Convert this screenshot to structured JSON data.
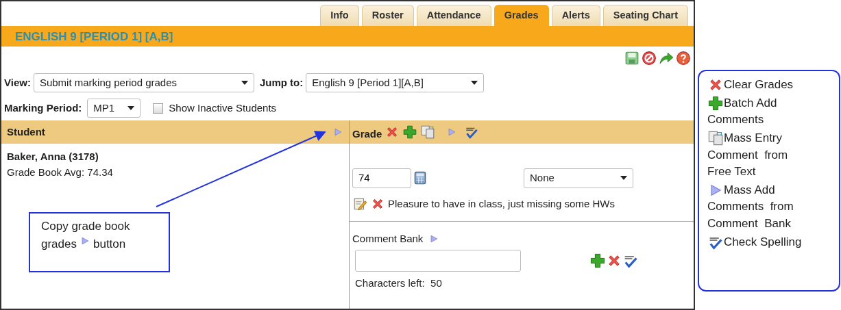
{
  "tabs": [
    {
      "label": "Info",
      "selected": false
    },
    {
      "label": "Roster",
      "selected": false
    },
    {
      "label": "Attendance",
      "selected": false
    },
    {
      "label": "Grades",
      "selected": true
    },
    {
      "label": "Alerts",
      "selected": false
    },
    {
      "label": "Seating Chart",
      "selected": false
    }
  ],
  "course_title": "ENGLISH 9 [PERIOD 1] [A,B]",
  "filters": {
    "view_label": "View:",
    "view_value": "Submit marking period grades",
    "jump_label": "Jump to:",
    "jump_value": "English 9 [Period 1][A,B]",
    "period_label": "Marking Period:",
    "period_value": "MP1",
    "inactive_label": "Show Inactive Students",
    "inactive_checked": false
  },
  "columns": {
    "student": "Student",
    "grade": "Grade"
  },
  "student": {
    "name": "Baker, Anna (3178)",
    "average": "Grade Book Avg: 74.34"
  },
  "grade": {
    "value": "74",
    "comment_code": "None",
    "comment": "Pleasure to have in class, just missing some HWs",
    "bank_label": "Comment Bank",
    "chars_left": "Characters left:  50"
  },
  "callout": {
    "line1": "Copy grade book",
    "line2_before": "grades",
    "line2_after": "button"
  },
  "legend": [
    {
      "kind": "clear",
      "lines": [
        "Clear Grades"
      ]
    },
    {
      "kind": "add",
      "lines": [
        "Batch Add",
        "Comments"
      ]
    },
    {
      "kind": "copy",
      "lines": [
        "Mass Entry",
        "Comment  from",
        "Free Text"
      ]
    },
    {
      "kind": "play",
      "lines": [
        "Mass Add",
        "Comments  from",
        "Comment  Bank"
      ]
    },
    {
      "kind": "spell",
      "lines": [
        "Check Spelling"
      ]
    }
  ]
}
